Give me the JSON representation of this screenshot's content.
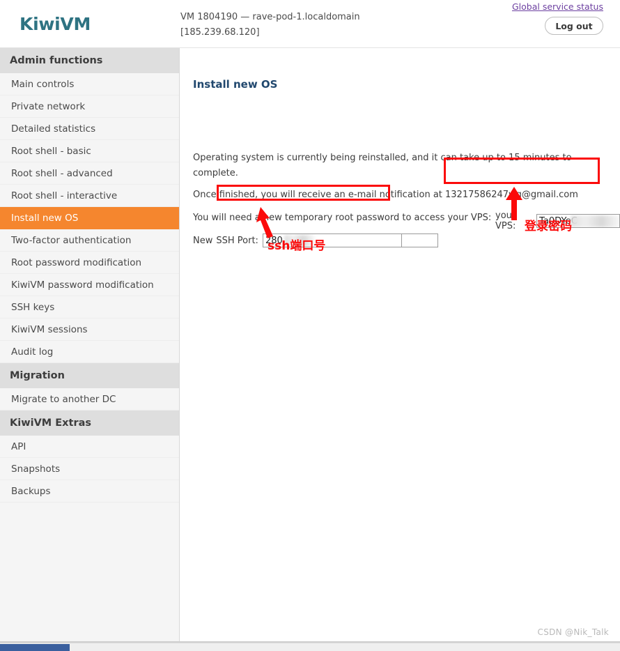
{
  "header": {
    "brand": "KiwiVM",
    "vm_line1": "VM 1804190 — rave-pod-1.localdomain",
    "vm_line2": "[185.239.68.120]",
    "status_link": "Global service status",
    "logout_label": "Log out"
  },
  "sidebar": {
    "groups": [
      {
        "title": "Admin functions",
        "items": [
          {
            "label": "Main controls",
            "active": false
          },
          {
            "label": "Private network",
            "active": false
          },
          {
            "label": "Detailed statistics",
            "active": false
          },
          {
            "label": "Root shell - basic",
            "active": false
          },
          {
            "label": "Root shell - advanced",
            "active": false
          },
          {
            "label": "Root shell - interactive",
            "active": false
          },
          {
            "label": "Install new OS",
            "active": true
          },
          {
            "label": "Two-factor authentication",
            "active": false
          },
          {
            "label": "Root password modification",
            "active": false
          },
          {
            "label": "KiwiVM password modification",
            "active": false
          },
          {
            "label": "SSH keys",
            "active": false
          },
          {
            "label": "KiwiVM sessions",
            "active": false
          },
          {
            "label": "Audit log",
            "active": false
          }
        ]
      },
      {
        "title": "Migration",
        "items": [
          {
            "label": "Migrate to another DC",
            "active": false
          }
        ]
      },
      {
        "title": "KiwiVM Extras",
        "items": [
          {
            "label": "API",
            "active": false
          },
          {
            "label": "Snapshots",
            "active": false
          },
          {
            "label": "Backups",
            "active": false
          }
        ]
      }
    ]
  },
  "main": {
    "heading": "Install new OS",
    "paragraph_1": "Operating system is currently being reinstalled, and it can take up to 15 minutes to complete.",
    "paragraph_2": "Once finished, you will receive an e-mail notification at 13217586247wg@gmail.com",
    "paragraph_3": "You will need a new temporary root password to access your VPS:",
    "ssh_label_new": "New",
    "ssh_label_port": "SSH Port:",
    "ssh_port_value": "280",
    "ssh_submit_value": "",
    "vps_password_label": "your VPS:",
    "vps_password_value": "Ta0DYeC"
  },
  "annotations": {
    "ssh_note": "ssh端口号",
    "password_note": "登录密码",
    "color": "#fb0a0a"
  },
  "footer": {
    "watermark": "CSDN @Nik_Talk"
  },
  "colors": {
    "accent_orange": "#f5862e",
    "brand_teal": "#2e7382",
    "heading_blue": "#21486e",
    "annotation_red": "#fb0a0a",
    "scrollbar_blue": "#3a5f9e"
  }
}
